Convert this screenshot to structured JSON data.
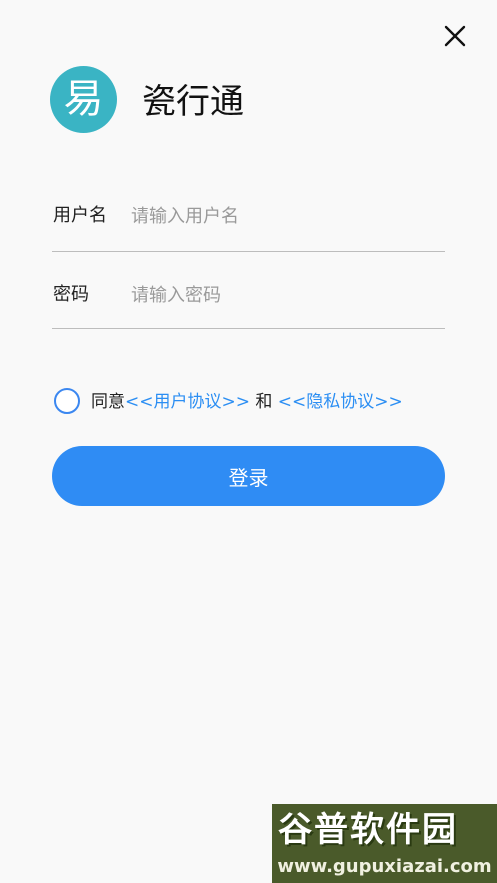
{
  "header": {
    "close_icon": "close-icon",
    "logo_glyph": "易",
    "app_name": "瓷行通"
  },
  "form": {
    "username": {
      "label": "用户名",
      "placeholder": "请输入用户名",
      "value": ""
    },
    "password": {
      "label": "密码",
      "placeholder": "请输入密码",
      "value": ""
    }
  },
  "agreement": {
    "checked": false,
    "prefix": "同意",
    "user_agreement": "<<用户协议>>",
    "conjunction": " 和 ",
    "privacy_agreement": "<<隐私协议>>"
  },
  "login_button": "登录",
  "watermark": {
    "title": "谷普软件园",
    "url": "www.gupuxiazai.com"
  },
  "colors": {
    "accent": "#2f8cf4",
    "link": "#2b8ef3",
    "logo_bg": "#3ab4c4",
    "background": "#f9f9f9"
  }
}
